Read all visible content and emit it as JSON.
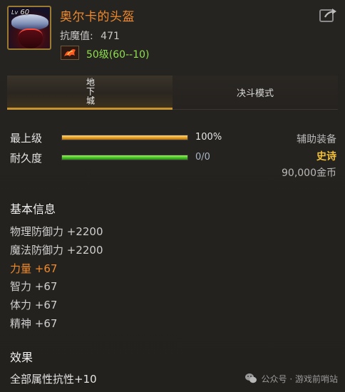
{
  "item": {
    "level_prefix": "Lv",
    "level_number": "60",
    "name": "奥尔卡的头盔",
    "resist_label": "抗魔值:",
    "resist_value": "471",
    "required_level": "50级(60--10)"
  },
  "tabs": [
    {
      "label": "地下城",
      "active": true
    },
    {
      "label": "决斗模式",
      "active": false
    }
  ],
  "bars": [
    {
      "label": "最上级",
      "fill": 1.0,
      "value_text": "100%",
      "color": "#e6a628"
    },
    {
      "label": "耐久度",
      "fill": 1.0,
      "value_text": "0/0",
      "color": "#4cc629"
    }
  ],
  "meta": {
    "category": "辅助装备",
    "rarity": "史诗",
    "rarity_color": "#f2c03a",
    "price": "90,000金币"
  },
  "basic_info": {
    "title": "基本信息",
    "stats": [
      {
        "text": "物理防御力 +2200",
        "highlight": false
      },
      {
        "text": "魔法防御力 +2200",
        "highlight": false
      },
      {
        "text": "力量 +67",
        "highlight": true
      },
      {
        "text": "智力 +67",
        "highlight": false
      },
      {
        "text": "体力 +67",
        "highlight": false
      },
      {
        "text": "精神 +67",
        "highlight": false
      }
    ]
  },
  "effects": {
    "title": "效果",
    "line": "全部属性抗性+10"
  },
  "watermark": {
    "text": "公众号 · 游戏前哨站"
  },
  "colors": {
    "name": "#f08a2c",
    "required_level": "#8ee04e",
    "tab_active_border": "#c89230"
  },
  "icons": [
    "helmet-item-icon",
    "share-icon",
    "phoenix-icon",
    "wechat-icon"
  ]
}
